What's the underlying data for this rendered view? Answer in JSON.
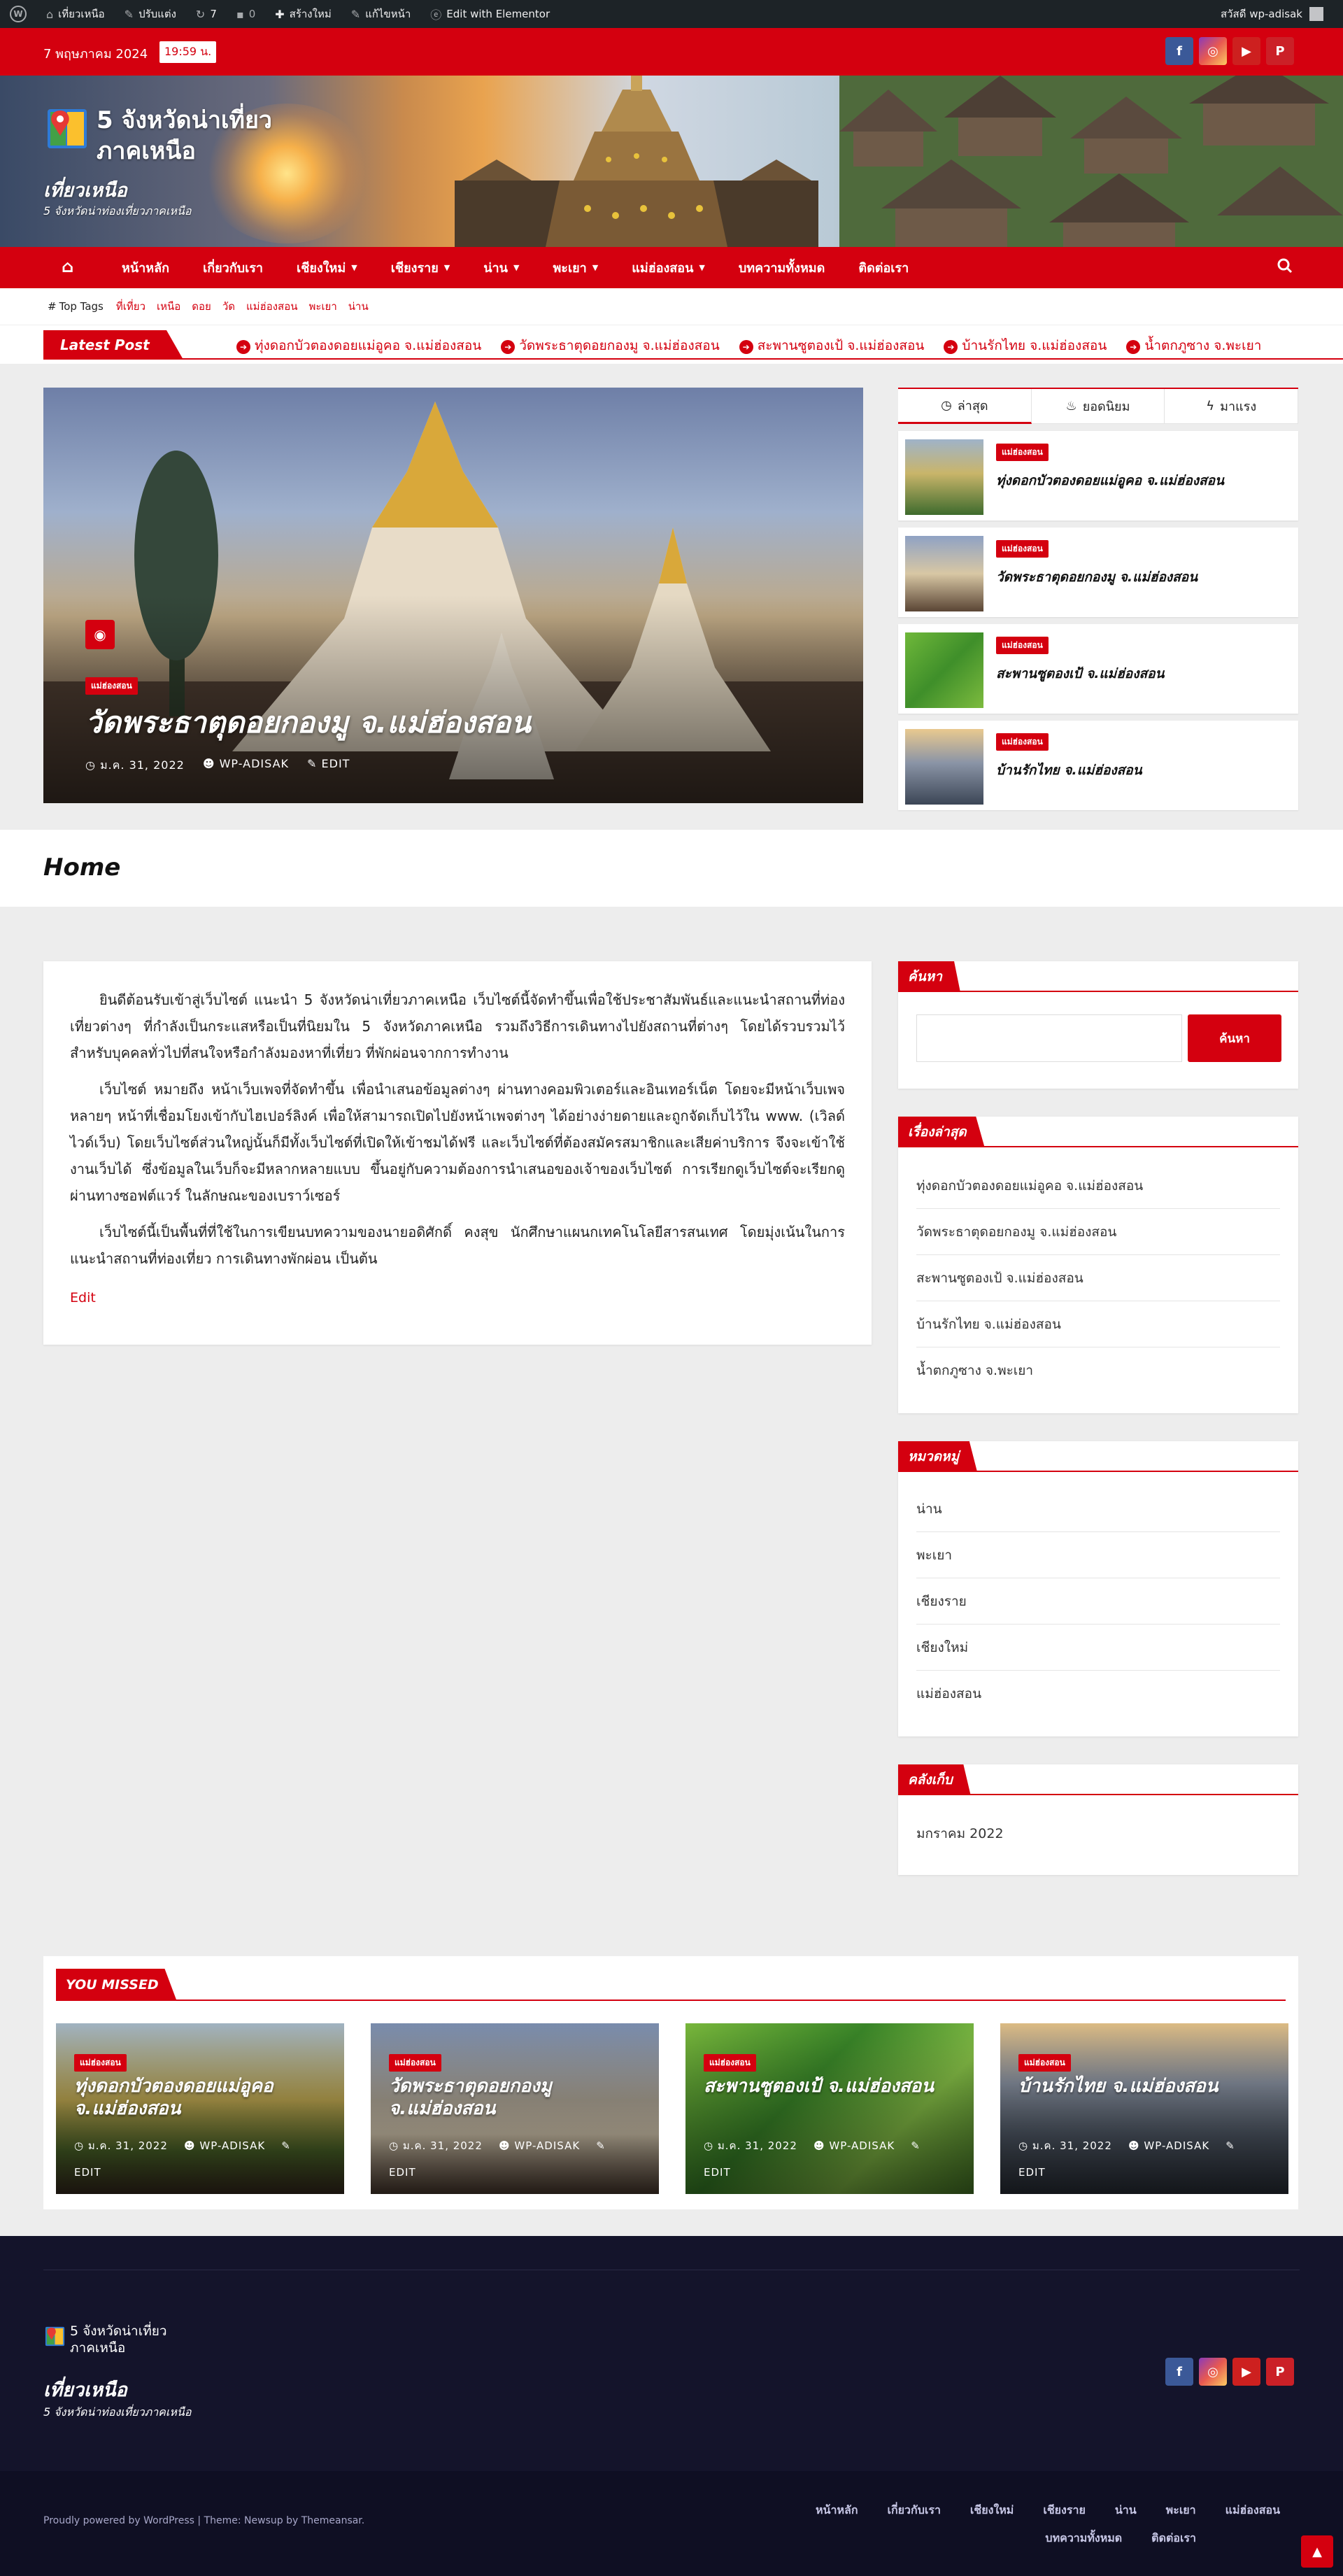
{
  "adminbar": {
    "items": [
      "เที่ยวเหนือ",
      "ปรับแต่ง",
      "7",
      "0",
      "สร้างใหม่",
      "แก้ไขหน้า",
      "Edit with Elementor"
    ],
    "greeting": "สวัสดี wp-adisak"
  },
  "topbar": {
    "date": "7 พฤษภาคม 2024",
    "time": "19:59 น."
  },
  "header": {
    "site_title": "5 จังหวัดน่าเที่ยว ภาคเหนือ",
    "site_subtitle": "เที่ยวเหนือ",
    "site_description": "5 จังหวัดน่าท่องเที่ยวภาคเหนือ"
  },
  "nav": {
    "items": [
      {
        "label": "หน้าหลัก",
        "dropdown": false
      },
      {
        "label": "เกี่ยวกับเรา",
        "dropdown": false
      },
      {
        "label": "เชียงใหม่",
        "dropdown": true
      },
      {
        "label": "เชียงราย",
        "dropdown": true
      },
      {
        "label": "น่าน",
        "dropdown": true
      },
      {
        "label": "พะเยา",
        "dropdown": true
      },
      {
        "label": "แม่ฮ่องสอน",
        "dropdown": true
      },
      {
        "label": "บทความทั้งหมด",
        "dropdown": false
      },
      {
        "label": "ติดต่อเรา",
        "dropdown": false
      }
    ]
  },
  "top_tags": {
    "label": "Top Tags",
    "tags": [
      "ที่เที่ยว",
      "เหนือ",
      "ดอย",
      "วัด",
      "แม่ฮ่องสอน",
      "พะเยา",
      "น่าน"
    ]
  },
  "latest": {
    "label": "Latest Post",
    "items": [
      "ทุ่งดอกบัวตองดอยแม่อูคอ จ.แม่ฮ่องสอน",
      "วัดพระธาตุดอยกองมู จ.แม่ฮ่องสอน",
      "สะพานซูตองเป้ จ.แม่ฮ่องสอน",
      "บ้านรักไทย จ.แม่ฮ่องสอน",
      "น้ำตกภูซาง จ.พะเยา"
    ]
  },
  "hero": {
    "category": "แม่ฮ่องสอน",
    "title": "วัดพระธาตุดอยกองมู จ.แม่ฮ่องสอน",
    "date": "ม.ค. 31, 2022",
    "author": "WP-ADISAK",
    "edit": "EDIT"
  },
  "tab_widget": {
    "tabs": [
      "ล่าสุด",
      "ยอดนิยม",
      "มาแรง"
    ],
    "items": [
      {
        "category": "แม่ฮ่องสอน",
        "title": "ทุ่งดอกบัวตองดอยแม่อูคอ จ.แม่ฮ่องสอน"
      },
      {
        "category": "แม่ฮ่องสอน",
        "title": "วัดพระธาตุดอยกองมู จ.แม่ฮ่องสอน"
      },
      {
        "category": "แม่ฮ่องสอน",
        "title": "สะพานซูตองเป้ จ.แม่ฮ่องสอน"
      },
      {
        "category": "แม่ฮ่องสอน",
        "title": "บ้านรักไทย จ.แม่ฮ่องสอน"
      }
    ]
  },
  "page": {
    "title": "Home",
    "paragraphs": [
      "ยินดีต้อนรับเข้าสู่เว็บไซต์ แนะนำ 5 จังหวัดน่าเที่ยวภาคเหนือ เว็บไซต์นี้จัดทำขึ้นเพื่อใช้ประชาสัมพันธ์และแนะนำสถานที่ท่องเที่ยวต่างๆ ที่กำลังเป็นกระแสหรือเป็นที่นิยมใน 5 จังหวัดภาคเหนือ รวมถึงวิธีการเดินทางไปยังสถานที่ต่างๆ โดยได้รวบรวมไว้สำหรับบุคคลทั่วไปที่สนใจหรือกำลังมองหาที่เที่ยว ที่พักผ่อนจากการทำงาน",
      "เว็บไซต์ หมายถึง หน้าเว็บเพจที่จัดทำขึ้น เพื่อนำเสนอข้อมูลต่างๆ ผ่านทางคอมพิวเตอร์และอินเทอร์เน็ต โดยจะมีหน้าเว็บเพจหลายๆ หน้าที่เชื่อมโยงเข้ากับไฮเปอร์ลิงค์ เพื่อให้สามารถเปิดไปยังหน้าเพจต่างๆ ได้อย่างง่ายดายและถูกจัดเก็บไว้ใน www. (เวิลด์ไวด์เว็บ) โดยเว็บไซต์ส่วนใหญ่นั้นก็มีทั้งเว็บไซต์ที่เปิดให้เข้าชมได้ฟรี และเว็บไซต์ที่ต้องสมัครสมาชิกและเสียค่าบริการ จึงจะเข้าใช้งานเว็บได้ ซึ่งข้อมูลในเว็บก็จะมีหลากหลายแบบ ขึ้นอยู่กับความต้องการนำเสนอของเจ้าของเว็บไซต์ การเรียกดูเว็บไซต์จะเรียกดูผ่านทางซอฟต์แวร์ ในลักษณะของเบราว์เซอร์",
      "เว็บไซต์นี้เป็นพื้นที่ที่ใช้ในการเขียนบทความของนายอดิศักดิ์ คงสุข นักศึกษาแผนกเทคโนโลยีสารสนเทศ โดยมุ่งเน้นในการแนะนำสถานที่ท่องเที่ยว การเดินทางพักผ่อน เป็นต้น"
    ],
    "edit": "Edit"
  },
  "sidebar": {
    "search": {
      "title": "ค้นหา",
      "button": "ค้นหา"
    },
    "recent": {
      "title": "เรื่องล่าสุด",
      "items": [
        "ทุ่งดอกบัวตองดอยแม่อูคอ จ.แม่ฮ่องสอน",
        "วัดพระธาตุดอยกองมู จ.แม่ฮ่องสอน",
        "สะพานซูตองเป้ จ.แม่ฮ่องสอน",
        "บ้านรักไทย จ.แม่ฮ่องสอน",
        "น้ำตกภูซาง จ.พะเยา"
      ]
    },
    "categories": {
      "title": "หมวดหมู่",
      "items": [
        "น่าน",
        "พะเยา",
        "เชียงราย",
        "เชียงใหม่",
        "แม่ฮ่องสอน"
      ]
    },
    "archives": {
      "title": "คลังเก็บ",
      "items": [
        "มกราคม 2022"
      ]
    }
  },
  "missed": {
    "title": "YOU MISSED",
    "cards": [
      {
        "category": "แม่ฮ่องสอน",
        "title": "ทุ่งดอกบัวตองดอยแม่อูคอ จ.แม่ฮ่องสอน",
        "date": "ม.ค. 31, 2022",
        "author": "WP-ADISAK",
        "edit": "EDIT"
      },
      {
        "category": "แม่ฮ่องสอน",
        "title": "วัดพระธาตุดอยกองมู จ.แม่ฮ่องสอน",
        "date": "ม.ค. 31, 2022",
        "author": "WP-ADISAK",
        "edit": "EDIT"
      },
      {
        "category": "แม่ฮ่องสอน",
        "title": "สะพานซูตองเป้ จ.แม่ฮ่องสอน",
        "date": "ม.ค. 31, 2022",
        "author": "WP-ADISAK",
        "edit": "EDIT"
      },
      {
        "category": "แม่ฮ่องสอน",
        "title": "บ้านรักไทย จ.แม่ฮ่องสอน",
        "date": "ม.ค. 31, 2022",
        "author": "WP-ADISAK",
        "edit": "EDIT"
      }
    ]
  },
  "footer": {
    "site_title": "5 จังหวัดน่าเที่ยว ภาคเหนือ",
    "site_subtitle": "เที่ยวเหนือ",
    "site_description": "5 จังหวัดน่าท่องเที่ยวภาคเหนือ",
    "copyright": "Proudly powered by WordPress | Theme: Newsup by Themeansar.",
    "nav_row1": [
      "หน้าหลัก",
      "เกี่ยวกับเรา",
      "เชียงใหม่",
      "เชียงราย",
      "น่าน",
      "พะเยา",
      "แม่ฮ่องสอน"
    ],
    "nav_row2": [
      "บทความทั้งหมด",
      "ติดต่อเรา"
    ]
  },
  "colors": {
    "accent": "#d4000f",
    "footer_bg": "#14142b"
  },
  "icons": [
    "wordpress-icon",
    "brush-icon",
    "refresh-icon",
    "comment-icon",
    "plus-icon",
    "pencil-icon",
    "elementor-icon",
    "facebook-icon",
    "instagram-icon",
    "youtube-icon",
    "pinterest-icon",
    "home-icon",
    "search-icon",
    "hash-icon",
    "camera-icon",
    "clock-icon",
    "user-icon",
    "edit-icon",
    "fire-icon",
    "bolt-icon",
    "arrow-up-icon"
  ]
}
